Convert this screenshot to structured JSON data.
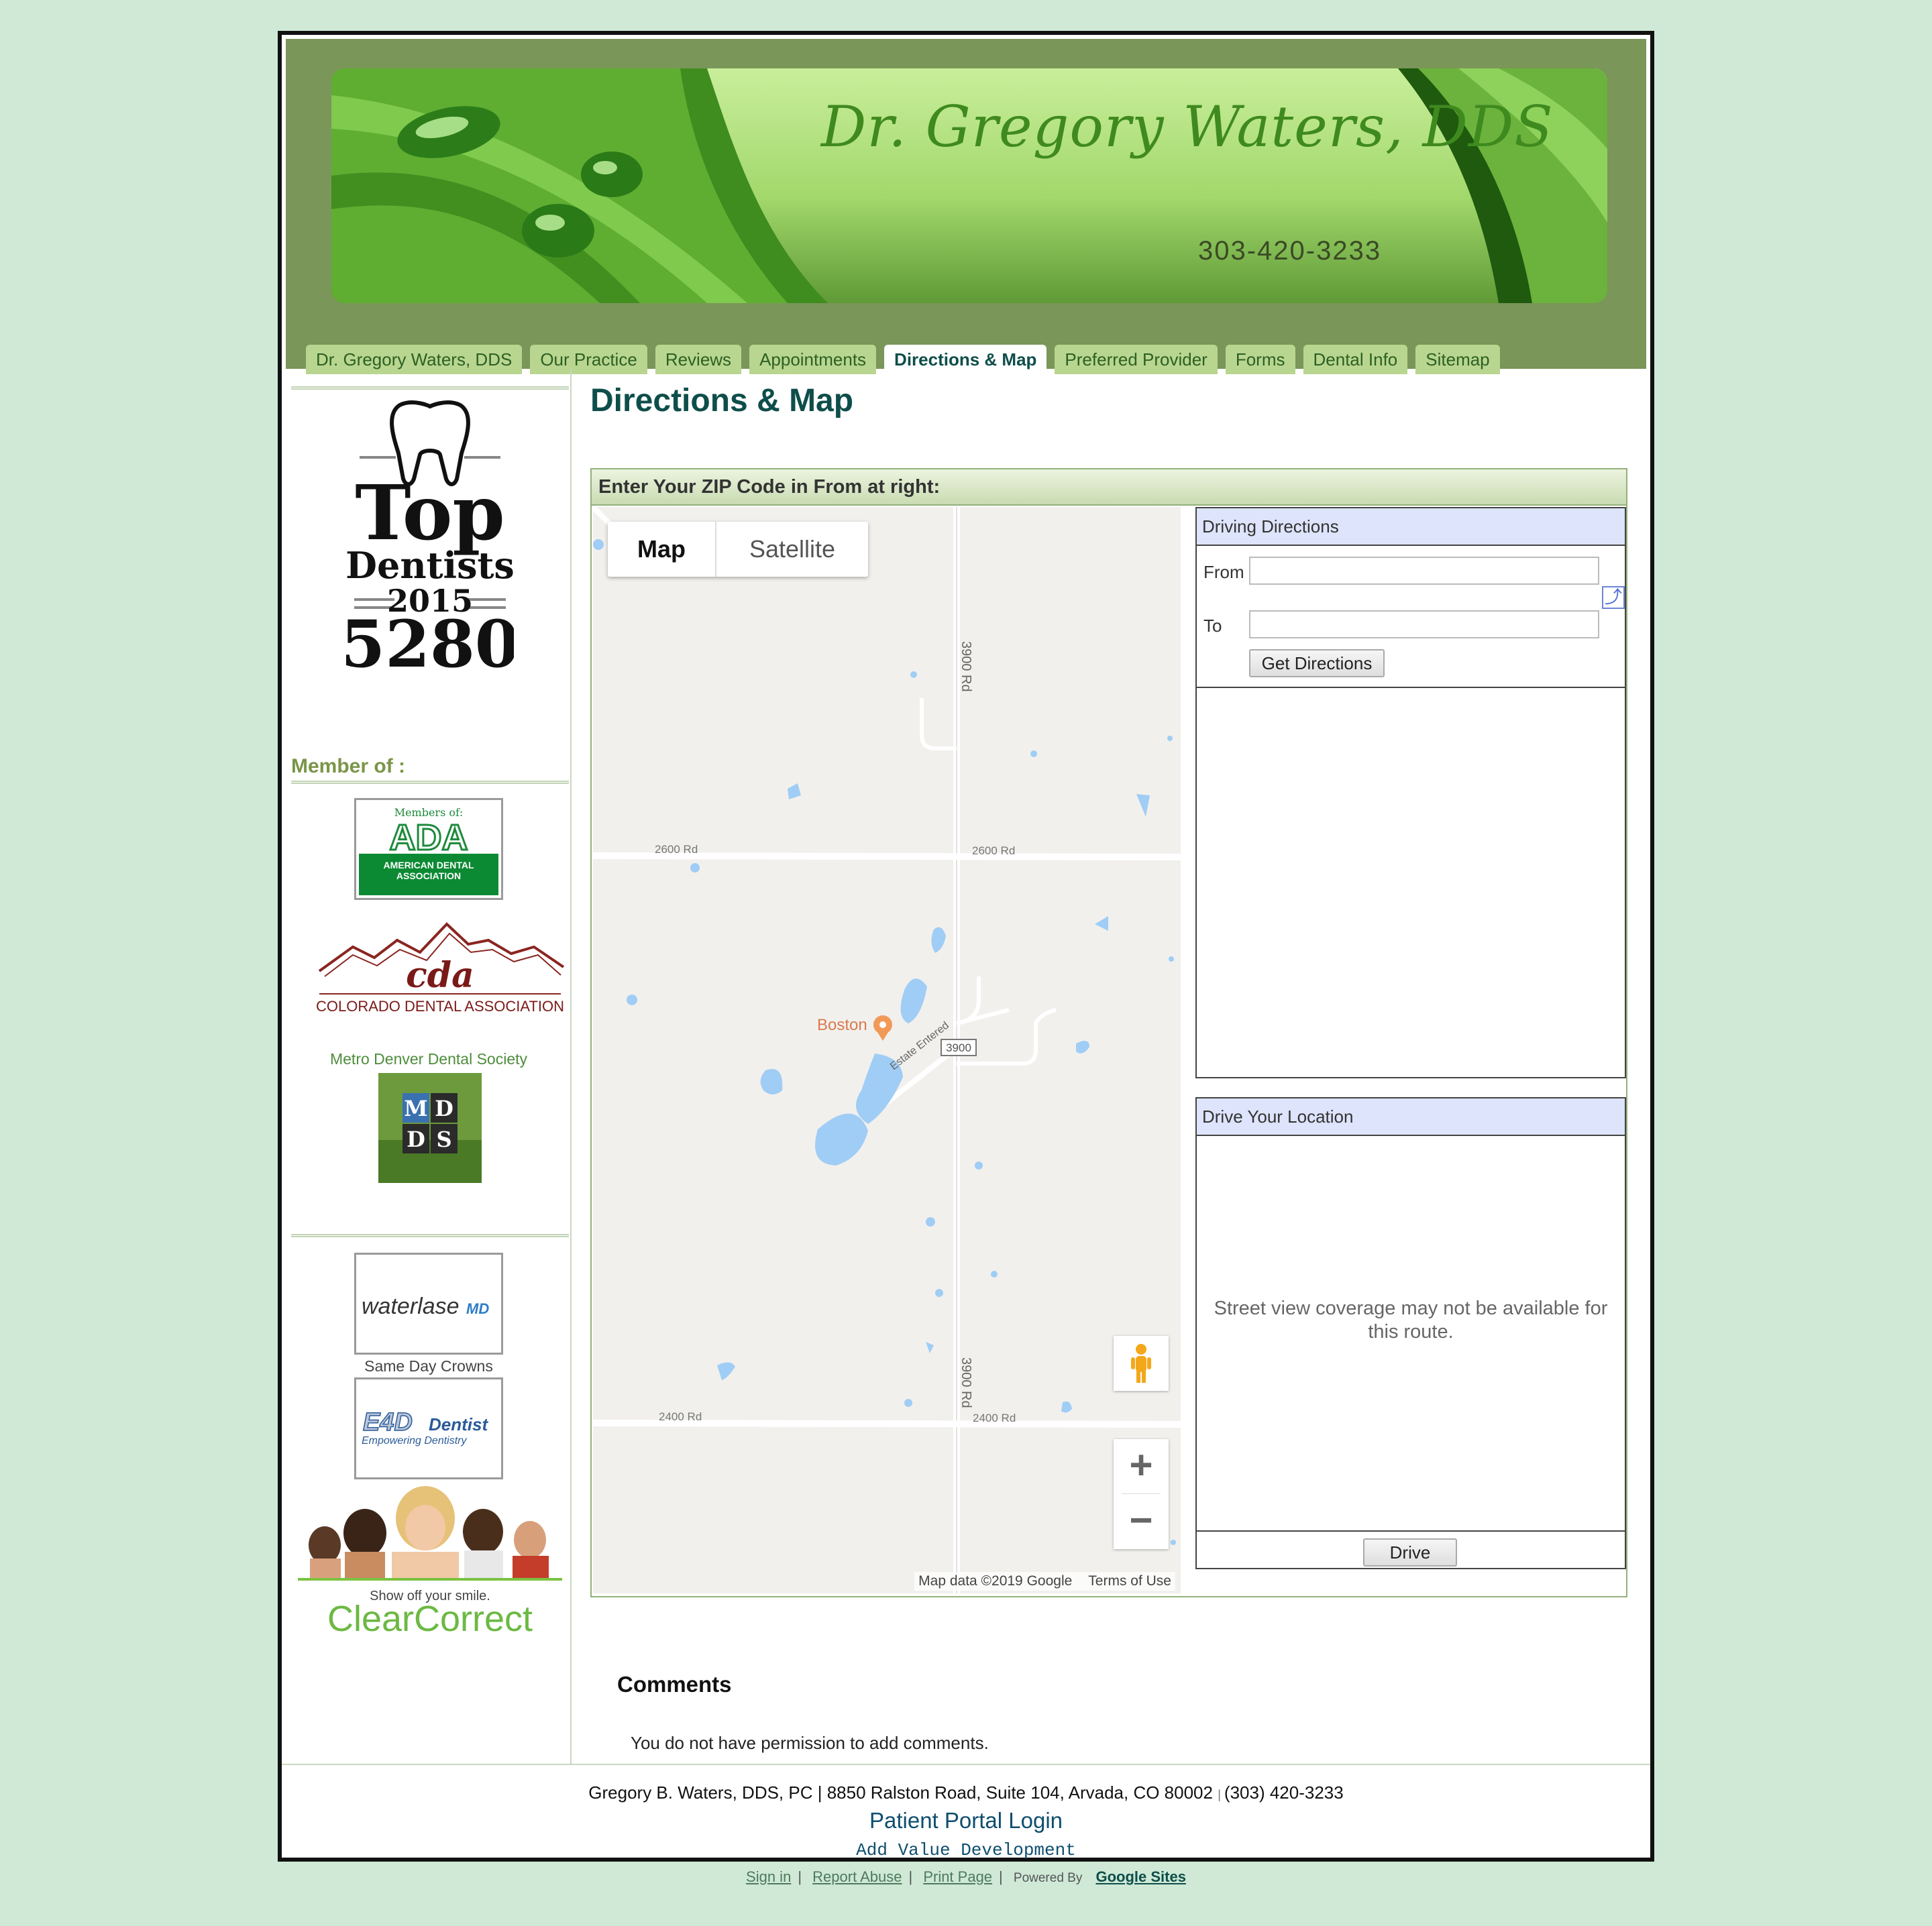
{
  "banner": {
    "title": "Dr. Gregory Waters, DDS",
    "phone": "303-420-3233"
  },
  "nav": {
    "tabs": [
      {
        "label": "Dr. Gregory Waters, DDS"
      },
      {
        "label": "Our Practice"
      },
      {
        "label": "Reviews"
      },
      {
        "label": "Appointments"
      },
      {
        "label": "Directions & Map"
      },
      {
        "label": "Preferred Provider"
      },
      {
        "label": "Forms"
      },
      {
        "label": "Dental Info"
      },
      {
        "label": "Sitemap"
      }
    ],
    "active": "Directions & Map"
  },
  "sidebar": {
    "top_dentists": {
      "word1": "Top",
      "word2": "Dentists",
      "year": "2015",
      "num": "5280"
    },
    "member_heading": "Member of :",
    "ada": {
      "line1": "Members of:",
      "logo": "ADA",
      "line2": "AMERICAN DENTAL",
      "line3": "ASSOCIATION"
    },
    "cda": {
      "logo": "cda",
      "name": "COLORADO DENTAL ASSOCIATION"
    },
    "mdds": {
      "caption": "Metro Denver Dental Society",
      "letters": [
        "M",
        "D",
        "D",
        "S"
      ]
    },
    "waterlase": {
      "logo": "waterlase",
      "suffix": "MD"
    },
    "crowns_caption": "Same Day Crowns",
    "e4d": {
      "logo": "E4D",
      "word": "Dentist",
      "tagline": "Empowering Dentistry"
    },
    "clearcorrect": {
      "tagline": "Show off your smile.",
      "logo": "ClearCorrect"
    }
  },
  "main": {
    "title": "Directions & Map",
    "zip_prompt": "Enter Your ZIP Code in From at right:",
    "map": {
      "type_map": "Map",
      "type_satellite": "Satellite",
      "place": "Boston",
      "roads": {
        "ns_top": "3900 Rd",
        "ns_bottom": "3900 Rd",
        "ew_top_left": "2600 Rd",
        "ew_top_right": "2600 Rd",
        "ew_bottom_left": "2400 Rd",
        "ew_bottom_right": "2400 Rd",
        "diag": "Estate Entered",
        "shield": "3900"
      },
      "attribution": "Map data ©2019 Google",
      "terms": "Terms of Use"
    },
    "driving": {
      "header": "Driving Directions",
      "from_label": "From",
      "to_label": "To",
      "from_value": "",
      "to_value": "",
      "button": "Get Directions"
    },
    "drive_location": {
      "header": "Drive Your Location",
      "message": "Street view coverage may not be available for this route.",
      "button": "Drive"
    },
    "comments": {
      "title": "Comments",
      "message": "You do not have permission to add comments."
    }
  },
  "footer": {
    "address": "Gregory B. Waters, DDS, PC | 8850 Ralston Road, Suite 104, Arvada, CO 80002",
    "phone": "(303) 420-3233",
    "portal": "Patient Portal Login",
    "developer": "Add Value Development"
  },
  "sitebar": {
    "sign_in": "Sign in",
    "report": "Report Abuse",
    "print": "Print Page",
    "powered": "Powered By",
    "google_sites": "Google Sites"
  },
  "colors": {
    "background": "#cfe9d6",
    "header": "#7a9658",
    "tab": "#b8d68f",
    "title": "#0e4e4a",
    "panel_head": "#dde4fb"
  }
}
